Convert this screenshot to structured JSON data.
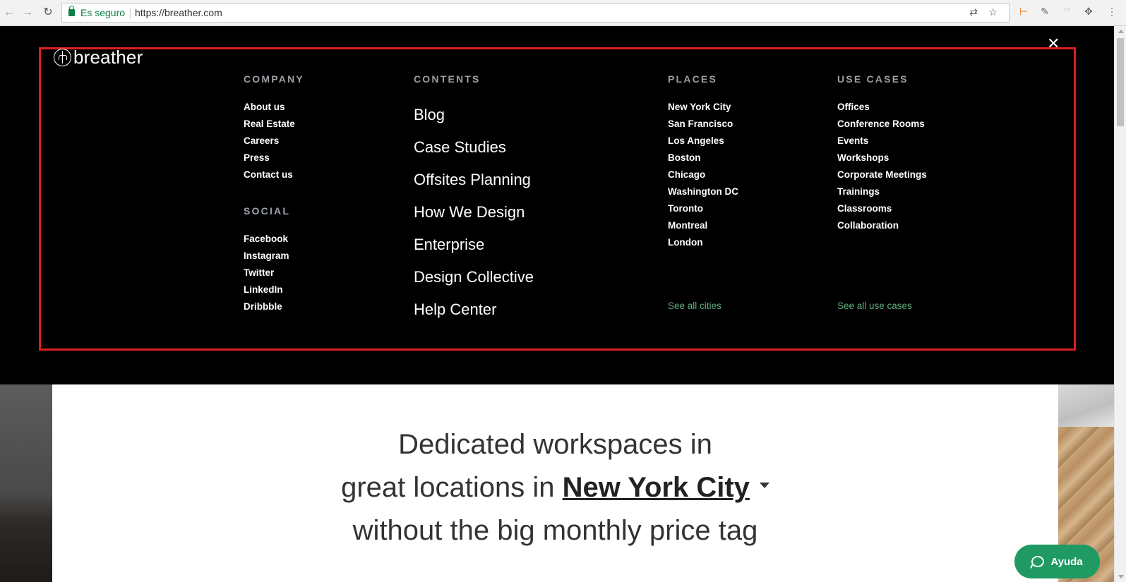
{
  "browser": {
    "secure_label": "Es seguro",
    "url": "https://breather.com"
  },
  "menu": {
    "logo_text": "breather",
    "close_symbol": "✕",
    "company": {
      "heading": "COMPANY",
      "items": [
        "About us",
        "Real Estate",
        "Careers",
        "Press",
        "Contact us"
      ]
    },
    "social": {
      "heading": "SOCIAL",
      "items": [
        "Facebook",
        "Instagram",
        "Twitter",
        "LinkedIn",
        "Dribbble"
      ]
    },
    "contents": {
      "heading": "CONTENTS",
      "items": [
        "Blog",
        "Case Studies",
        "Offsites Planning",
        "How We Design",
        "Enterprise",
        "Design Collective",
        "Help Center"
      ]
    },
    "places": {
      "heading": "PLACES",
      "items": [
        "New York City",
        "San Francisco",
        "Los Angeles",
        "Boston",
        "Chicago",
        "Washington DC",
        "Toronto",
        "Montreal",
        "London"
      ],
      "see_all": "See all cities"
    },
    "use_cases": {
      "heading": "USE CASES",
      "items": [
        "Offices",
        "Conference Rooms",
        "Events",
        "Workshops",
        "Corporate Meetings",
        "Trainings",
        "Classrooms",
        "Collaboration"
      ],
      "see_all": "See all use cases"
    },
    "highlight_color": "#e01e1e",
    "link_color": "#5fae7e"
  },
  "hero": {
    "line1": "Dedicated workspaces in",
    "line2_prefix": "great locations in",
    "city": "New York City",
    "line3": "without the big monthly price tag"
  },
  "help_button": {
    "label": "Ayuda",
    "color": "#1e9a62"
  }
}
